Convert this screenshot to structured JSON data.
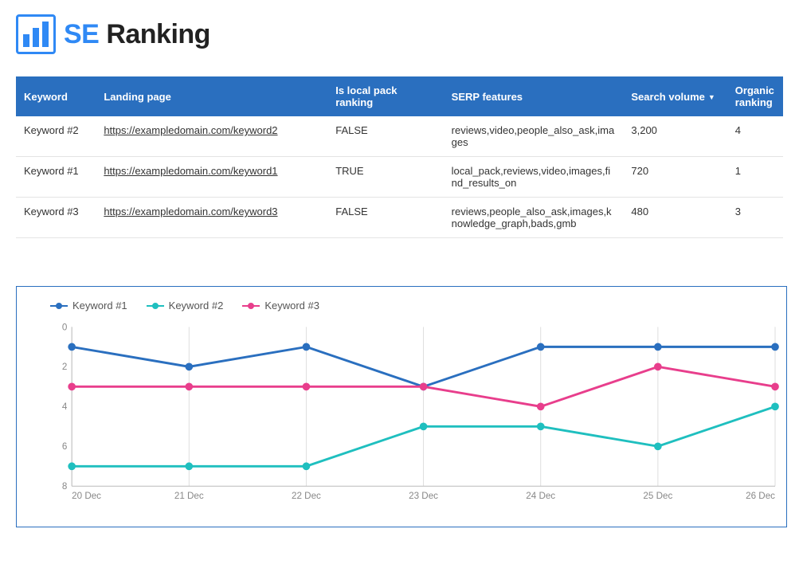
{
  "brand": {
    "se": "SE",
    "ranking": "Ranking"
  },
  "table": {
    "headers": {
      "keyword": "Keyword",
      "landing_page": "Landing page",
      "is_local": "Is local pack ranking",
      "serp": "SERP features",
      "volume": "Search volume",
      "organic": "Organic ranking"
    },
    "sort_indicator": "▼",
    "rows": [
      {
        "keyword": "Keyword #2",
        "url": "https://exampledomain.com/keyword2",
        "is_local": "FALSE",
        "serp": "reviews,video,people_also_ask,images",
        "volume": "3,200",
        "organic": "4"
      },
      {
        "keyword": "Keyword #1",
        "url": "https://exampledomain.com/keyword1",
        "is_local": "TRUE",
        "serp": "local_pack,reviews,video,images,find_results_on",
        "volume": "720",
        "organic": "1"
      },
      {
        "keyword": "Keyword #3",
        "url": "https://exampledomain.com/keyword3",
        "is_local": "FALSE",
        "serp": "reviews,people_also_ask,images,knowledge_graph,bads,gmb",
        "volume": "480",
        "organic": "3"
      }
    ]
  },
  "chart_data": {
    "type": "line",
    "title": "",
    "xlabel": "",
    "ylabel": "",
    "ylim": [
      0,
      8
    ],
    "y_inverted": true,
    "categories": [
      "20 Dec",
      "21 Dec",
      "22 Dec",
      "23 Dec",
      "24 Dec",
      "25 Dec",
      "26 Dec"
    ],
    "series": [
      {
        "name": "Keyword #1",
        "color": "#2a6fbf",
        "values": [
          1,
          2,
          1,
          3,
          1,
          1,
          1
        ]
      },
      {
        "name": "Keyword #2",
        "color": "#1fbfbf",
        "values": [
          7,
          7,
          7,
          5,
          5,
          6,
          4
        ]
      },
      {
        "name": "Keyword #3",
        "color": "#e83e8c",
        "values": [
          3,
          3,
          3,
          3,
          4,
          2,
          3
        ]
      }
    ]
  }
}
